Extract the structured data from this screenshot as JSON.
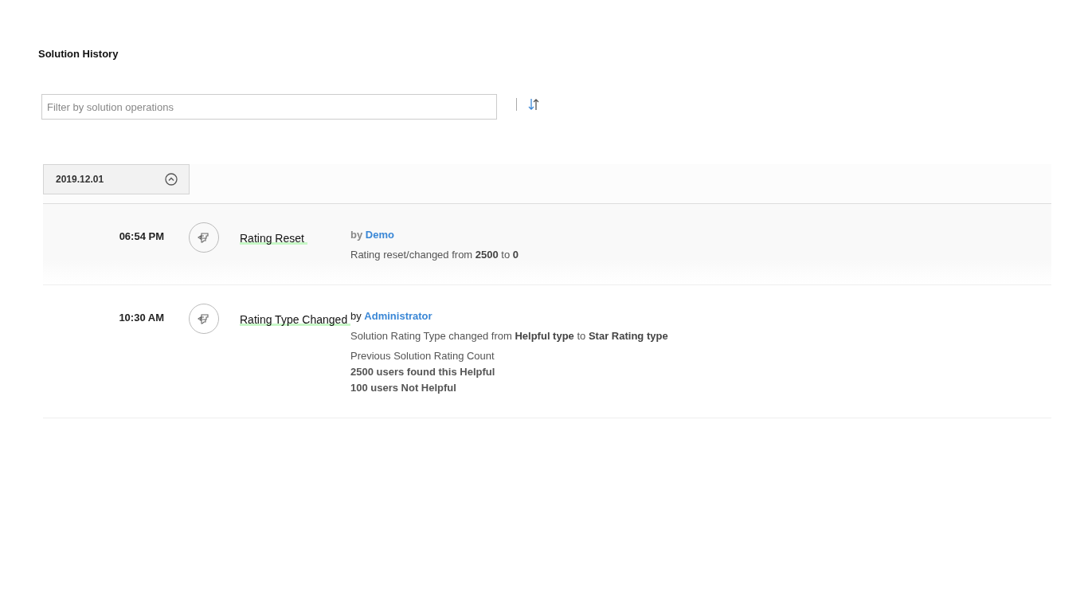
{
  "title": "Solution History",
  "filter": {
    "placeholder": "Filter by solution operations"
  },
  "group": {
    "date": "2019.12.01",
    "expanded": true
  },
  "entries": [
    {
      "time": "06:54 PM",
      "title": "Rating Reset",
      "highlighted": true,
      "by": "by",
      "author": "Demo",
      "paragraphs": [
        [
          {
            "text": "Rating reset/changed from **2500** to **0**",
            "bold": false
          }
        ]
      ]
    },
    {
      "time": "10:30 AM",
      "title": "Rating Type Changed",
      "highlighted": false,
      "by": "by",
      "author": "Administrator",
      "paragraphs": [
        [
          {
            "text": "Solution Rating Type changed from **Helpful type** to **Star Rating type**",
            "bold": false
          }
        ],
        [
          {
            "text": "Previous Solution Rating Count",
            "bold": false
          },
          {
            "text": "2500 users found this Helpful",
            "bold": true
          },
          {
            "text": "100 users Not Helpful",
            "bold": true
          }
        ]
      ]
    }
  ]
}
